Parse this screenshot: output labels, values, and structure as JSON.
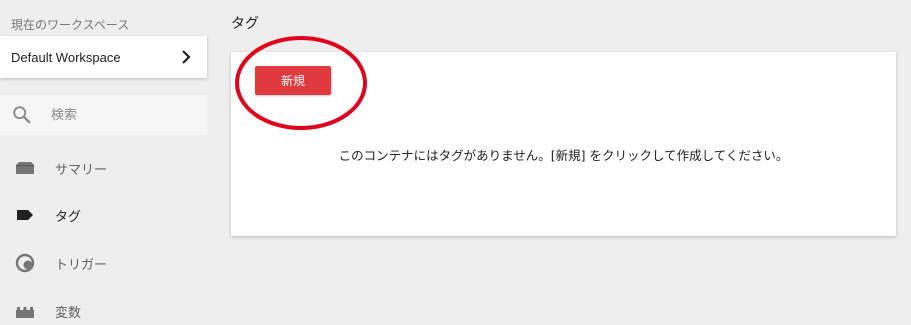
{
  "sidebar": {
    "workspace_label": "現在のワークスペース",
    "workspace_name": "Default Workspace",
    "search_placeholder": "検索",
    "items": [
      {
        "label": "サマリー",
        "icon": "folder-icon"
      },
      {
        "label": "タグ",
        "icon": "tag-icon"
      },
      {
        "label": "トリガー",
        "icon": "trigger-icon"
      },
      {
        "label": "変数",
        "icon": "variables-icon"
      }
    ]
  },
  "main": {
    "title": "タグ",
    "new_button_label": "新規",
    "empty_message": "このコンテナにはタグがありません。[新規] をクリックして作成してください。"
  },
  "colors": {
    "accent": "#e0393e",
    "annotation": "#e0001b",
    "background": "#eeeeee"
  }
}
